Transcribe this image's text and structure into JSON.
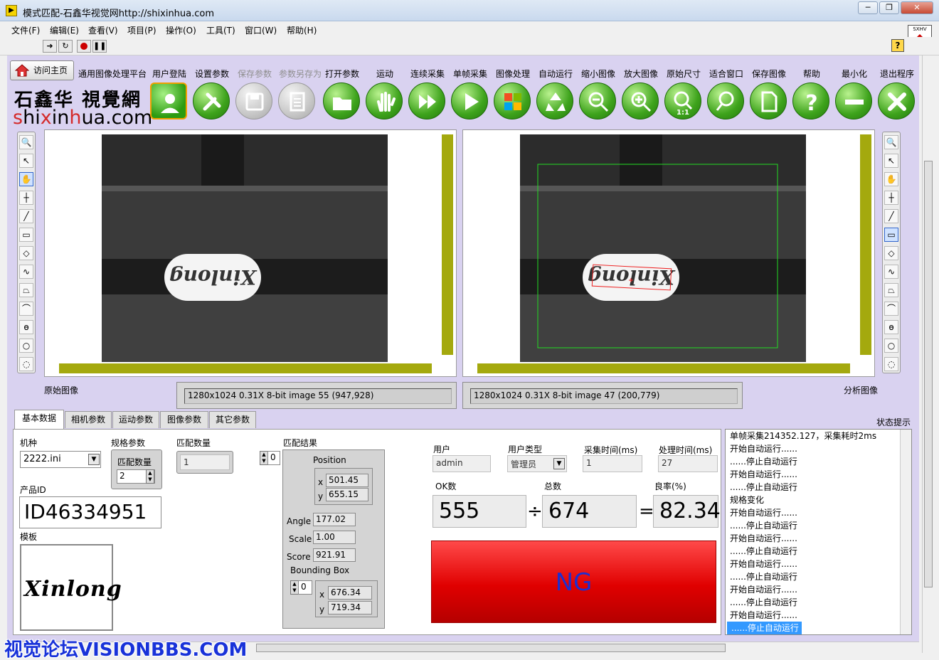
{
  "window": {
    "title": "模式匹配-石鑫华视觉网http://shixinhua.com",
    "minimize": "─",
    "restore": "❐",
    "close": "✕"
  },
  "menu": [
    "文件(F)",
    "编辑(E)",
    "查看(V)",
    "项目(P)",
    "操作(O)",
    "工具(T)",
    "窗口(W)",
    "帮助(H)"
  ],
  "toolbar_icons": [
    "run-arrow-icon",
    "run-continuous-icon",
    "abort-icon",
    "pause-icon"
  ],
  "home_button": "访问主页",
  "platform_label": "通用图像处理平台",
  "main_buttons": [
    {
      "label": "用户登陆",
      "icon": "user-icon",
      "enabled": true
    },
    {
      "label": "设置参数",
      "icon": "tools-icon",
      "enabled": true
    },
    {
      "label": "保存参数",
      "icon": "save-icon",
      "enabled": false
    },
    {
      "label": "参数另存为",
      "icon": "save-as-icon",
      "enabled": false
    },
    {
      "label": "打开参数",
      "icon": "folder-icon",
      "enabled": true
    },
    {
      "label": "运动",
      "icon": "hand-icon",
      "enabled": true
    },
    {
      "label": "连续采集",
      "icon": "fast-forward-icon",
      "enabled": true
    },
    {
      "label": "单帧采集",
      "icon": "play-icon",
      "enabled": true
    },
    {
      "label": "图像处理",
      "icon": "windows-icon",
      "enabled": true
    },
    {
      "label": "自动运行",
      "icon": "recycle-icon",
      "enabled": true
    },
    {
      "label": "缩小图像",
      "icon": "zoom-out-icon",
      "enabled": true
    },
    {
      "label": "放大图像",
      "icon": "zoom-in-icon",
      "enabled": true
    },
    {
      "label": "原始尺寸",
      "icon": "zoom-1to1-icon",
      "enabled": true
    },
    {
      "label": "适合窗口",
      "icon": "zoom-fit-icon",
      "enabled": true
    },
    {
      "label": "保存图像",
      "icon": "document-icon",
      "enabled": true
    },
    {
      "label": "帮助",
      "icon": "help-icon",
      "enabled": true
    },
    {
      "label": "最小化",
      "icon": "minus-icon",
      "enabled": true
    },
    {
      "label": "退出程序",
      "icon": "exit-icon",
      "enabled": true
    }
  ],
  "brand": {
    "cn": "石鑫华 視覺網",
    "en_s": "s",
    "en_h": "hi",
    "en_x": "x",
    "en_in": "in",
    "en_h2": "h",
    "en_rest": "ua.com"
  },
  "zoom_one_to_one": "1:1",
  "image_left": {
    "caption": "原始图像",
    "info": "1280x1024 0.31X 8-bit image 55     (947,928)",
    "text": "Xinlong"
  },
  "image_right": {
    "caption": "分析图像",
    "info": "1280x1024 0.31X 8-bit image 47     (200,779)",
    "text": "Xinlong"
  },
  "tabs": [
    "基本数据",
    "相机参数",
    "运动参数",
    "图像参数",
    "其它参数"
  ],
  "status_title": "状态提示",
  "basic": {
    "model_label": "机种",
    "model_value": "2222.ini",
    "spec_label": "规格参数",
    "match_count_label": "匹配数量",
    "match_count_value": "2",
    "match_num_label": "匹配数量",
    "match_num_value": "1",
    "result_label": "匹配结果",
    "result_index": "0",
    "position_label": "Position",
    "pos_x": "501.45",
    "pos_y": "655.15",
    "angle_label": "Angle",
    "angle": "177.02",
    "scale_label": "Scale",
    "scale": "1.00",
    "score_label": "Score",
    "score": "921.91",
    "bbox_label": "Bounding Box",
    "bbox_index": "0",
    "bbox_x": "676.34",
    "bbox_y": "719.34",
    "x_label": "x",
    "y_label": "y",
    "product_id_label": "产品ID",
    "product_id": "ID46334951",
    "template_label": "模板",
    "template_text": "Xinlong"
  },
  "stats": {
    "user_label": "用户",
    "user": "admin",
    "user_type_label": "用户类型",
    "user_type": "管理员",
    "acq_time_label": "采集时间(ms)",
    "acq_time": "1",
    "proc_time_label": "处理时间(ms)",
    "proc_time": "27",
    "ok_label": "OK数",
    "ok": "555",
    "total_label": "总数",
    "total": "674",
    "yield_label": "良率(%)",
    "yield": "82.34",
    "div": "÷",
    "eq": "=",
    "result": "NG"
  },
  "log": [
    "单帧采集214352.127，采集耗时2ms",
    "开始自动运行......",
    "......停止自动运行",
    "开始自动运行......",
    "......停止自动运行",
    "规格变化",
    "开始自动运行......",
    "......停止自动运行",
    "开始自动运行......",
    "......停止自动运行",
    "开始自动运行......",
    "......停止自动运行",
    "开始自动运行......",
    "......停止自动运行",
    "开始自动运行......",
    "......停止自动运行"
  ],
  "watermark": "视觉论坛VISIONBBS.COM",
  "colors": {
    "panel": "#d9d2f0",
    "scroll": "#a4a90e",
    "ng": "#e00000",
    "ng_text": "#1c2fd1",
    "green_btn": "#3ea31c"
  }
}
